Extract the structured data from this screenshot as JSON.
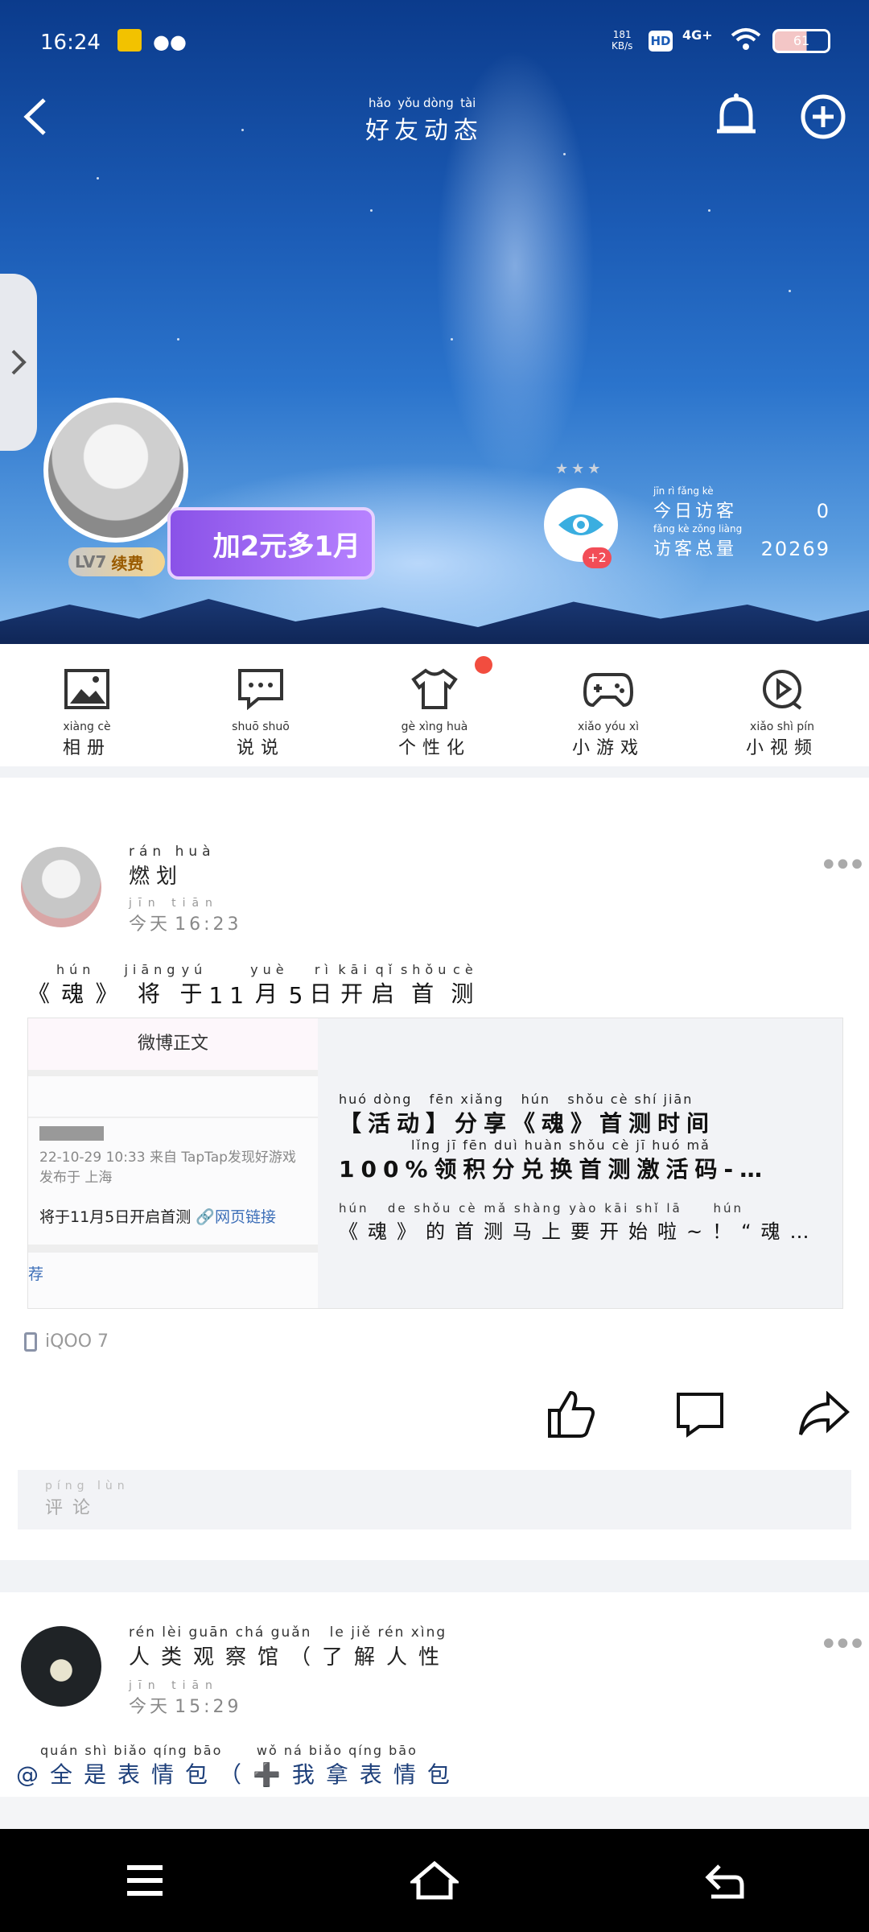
{
  "status_bar": {
    "time": "16:24",
    "net_speed_value": "181",
    "net_speed_unit": "KB/s",
    "hd": "HD",
    "signal": "4G+",
    "battery": "61"
  },
  "header": {
    "title": [
      {
        "py": "hǎo",
        "hz": "好"
      },
      {
        "py": "yǒu",
        "hz": "友"
      },
      {
        "py": "dòng",
        "hz": "动"
      },
      {
        "py": "tài",
        "hz": "态"
      }
    ],
    "level_badge": "LV7",
    "renew_label": "续费",
    "promo_text": "加2元多1月",
    "eye_badge": "+2",
    "stats": {
      "today_label_py": "jīn rì fǎng kè",
      "today_label": "今日访客",
      "today_value": "0",
      "total_label_py": "fǎng kè zǒng liàng",
      "total_label": "访客总量",
      "total_value": "20269"
    }
  },
  "nav": [
    {
      "py": "xiàng cè",
      "label": "相册",
      "icon": "album-icon"
    },
    {
      "py": "shuō shuō",
      "label": "说说",
      "icon": "chat-icon"
    },
    {
      "py": "gè xìng huà",
      "label": "个性化",
      "icon": "shirt-icon"
    },
    {
      "py": "xiǎo yóu xì",
      "label": "小游戏",
      "icon": "gamepad-icon"
    },
    {
      "py": "xiǎo shì pín",
      "label": "小视频",
      "icon": "video-icon"
    }
  ],
  "post1": {
    "name_py": "rán huà",
    "name": "燃划",
    "time_py": "jīn tiān",
    "time_hz": "今天",
    "time": "16:23",
    "text_py": [
      "",
      "hún",
      "",
      "jiāng",
      "yú",
      "",
      "",
      "yuè",
      "",
      "rì",
      "kāi",
      "qǐ",
      "shǒu",
      "cè"
    ],
    "text_hz": [
      "《",
      "魂",
      "》",
      "将",
      "于",
      "11",
      "",
      "月",
      "5",
      "日",
      "开",
      "启",
      "首",
      "测"
    ],
    "card": {
      "thumb_header": "微博正文",
      "thumb_meta": "22-10-29 10:33  来自 TapTap发现好游戏",
      "thumb_loc": "发布于 上海",
      "thumb_body": "将于11月5日开启首测",
      "thumb_link": "🔗网页链接",
      "thumb_tag": "荐",
      "title_line1_py": "huó dòng   fēn xiǎng   hún   shǒu cè shí jiān",
      "title_line1": "【活动】分享《魂》首测时间",
      "title_line2_py": "lǐng jī fēn duì huàn shǒu cè jī huó mǎ",
      "title_line2": "100%领积分兑换首测激活码-…",
      "desc_py": "hún   de shǒu cè mǎ shàng yào kāi shǐ lā     hún",
      "desc": "《魂》的首测马上要开始啦~！“魂…"
    },
    "device": "iQOO 7"
  },
  "comment": {
    "py": "píng lùn",
    "label": "评论"
  },
  "post2": {
    "name_py": "rén lèi guān chá guǎn   le jiě rén xìng",
    "name": "人类观察馆（了解人性",
    "time_py": "jīn tiān",
    "time_hz": "今天",
    "time": "15:29",
    "text_py": "quán shì biǎo qíng bāo      wǒ ná biǎo qíng bāo",
    "text": "@全是表情包（➕我拿表情包"
  },
  "colors": {
    "accent": "#f24d3f",
    "purple": "#8a52e8",
    "eye_blue": "#3aaee0"
  }
}
